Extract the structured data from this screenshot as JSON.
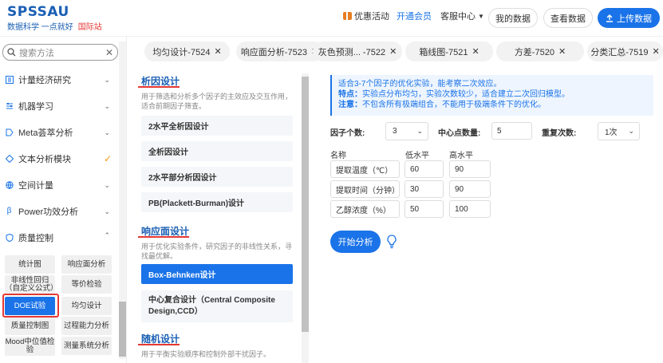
{
  "header": {
    "logo": "SPSSAU",
    "slogan": "数据科学 一点就好",
    "intl": "国际站",
    "promo": "优惠活动",
    "vip": "开通会员",
    "service": "客服中心",
    "my_data": "我的数据",
    "view_data": "查看数据",
    "upload": "上传数据"
  },
  "sidebar": {
    "search_placeholder": "搜索方法",
    "items": [
      {
        "label": "计量经济研究",
        "icon": "grid-icon"
      },
      {
        "label": "机器学习",
        "icon": "sliders-icon"
      },
      {
        "label": "Meta荟萃分析",
        "icon": "tag-icon"
      },
      {
        "label": "文本分析模块",
        "icon": "diamond-icon"
      },
      {
        "label": "空间计量",
        "icon": "globe-icon"
      },
      {
        "label": "Power功效分析",
        "icon": "beta-icon"
      },
      {
        "label": "质量控制",
        "icon": "shield-icon"
      }
    ],
    "sub_items": [
      "统计图",
      "响应面分析",
      "非线性回归（自定义公式）",
      "等价检验",
      "DOE试验",
      "均匀设计",
      "质量控制图",
      "过程能力分析",
      "Mood中位值检验",
      "测量系统分析"
    ],
    "active_sub": "DOE试验"
  },
  "tabs": [
    "均匀设计-7524",
    "响应面分析-7523",
    "灰色预测... -7522",
    "箱线图-7521",
    "方差-7520",
    "分类汇总-7519"
  ],
  "middle": {
    "sec1_title": "析因设计",
    "sec1_desc": "用于筛选和分析多个因子的主效应及交互作用，适合前期因子筛查。",
    "sec1_opts": [
      "2水平全析因设计",
      "全析因设计",
      "2水平部分析因设计",
      "PB(Plackett-Burman)设计"
    ],
    "sec2_title": "响应面设计",
    "sec2_desc": "用于优化实验条件，研究因子的非线性关系，寻找最优解。",
    "sec2_opts": [
      "Box-Behnken设计",
      "中心复合设计（Central Composite Design,CCD）"
    ],
    "sec3_title": "随机设计",
    "sec3_desc": "用于平衡实验顺序和控制外部干扰因子。"
  },
  "info": {
    "line1": "适合3-7个因子的优化实验，能考察二次效应。",
    "feat_label": "特点：",
    "feat_text": "实验点分布均匀，实验次数较少，适合建立二次回归模型。",
    "note_label": "注意：",
    "note_text": "不包含所有极端组合，不能用于极端条件下的优化。"
  },
  "params": {
    "factors_label": "因子个数:",
    "factors_value": "3",
    "center_label": "中心点数量:",
    "center_value": "5",
    "repeat_label": "重复次数:",
    "repeat_value": "1次"
  },
  "table": {
    "headers": [
      "名称",
      "低水平",
      "高水平"
    ],
    "rows": [
      [
        "提取温度（℃）",
        "60",
        "90"
      ],
      [
        "提取时间（分钟）",
        "30",
        "90"
      ],
      [
        "乙醇浓度（%）",
        "50",
        "100"
      ]
    ]
  },
  "run_label": "开始分析",
  "colors": {
    "accent": "#1a73e8",
    "highlight": "#e53935"
  }
}
